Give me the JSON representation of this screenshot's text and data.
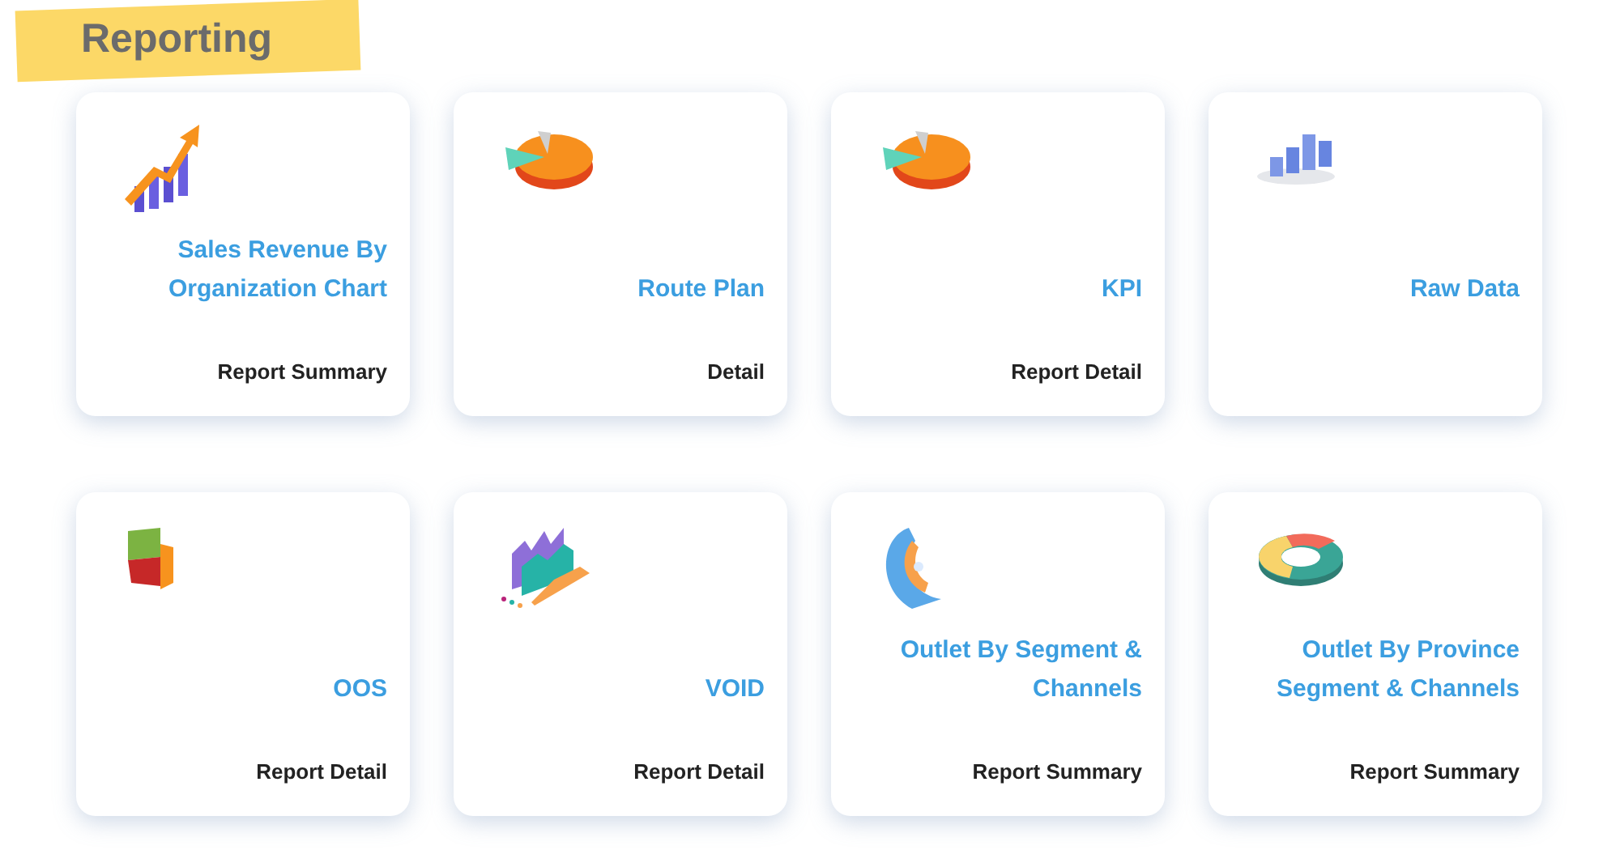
{
  "heading": "Reporting",
  "cards": [
    {
      "kind": "growth",
      "title_lines": [
        "Sales Revenue By",
        "Organization Chart"
      ],
      "subtitle": "Report Summary"
    },
    {
      "kind": "pie",
      "title_lines": [
        "Route Plan"
      ],
      "subtitle": "Detail"
    },
    {
      "kind": "pie",
      "title_lines": [
        "KPI"
      ],
      "subtitle": "Report Detail"
    },
    {
      "kind": "bars",
      "title_lines": [
        "Raw Data"
      ]
    },
    {
      "kind": "stack",
      "title_lines": [
        "OOS"
      ],
      "subtitle": "Report Detail"
    },
    {
      "kind": "area",
      "title_lines": [
        "VOID"
      ],
      "subtitle": "Report Detail"
    },
    {
      "kind": "arc",
      "title_lines": [
        "Outlet By Segment &",
        "Channels"
      ],
      "subtitle": "Report Summary"
    },
    {
      "kind": "ring",
      "title_lines": [
        "Outlet By Province",
        "Segment & Channels"
      ],
      "subtitle": "Report Summary"
    }
  ]
}
